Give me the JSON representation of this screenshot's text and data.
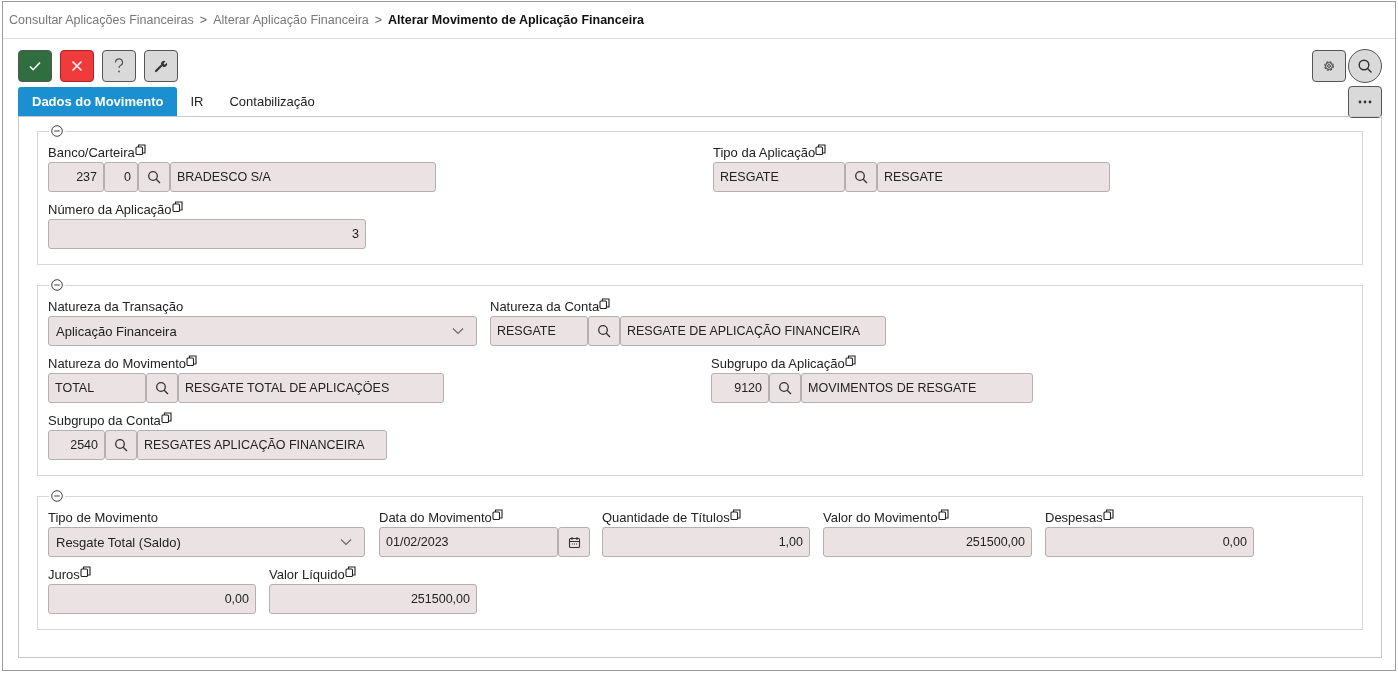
{
  "breadcrumb": [
    {
      "label": "Consultar Aplicações Financeiras",
      "current": false
    },
    {
      "label": "Alterar Aplicação Financeira",
      "current": false
    },
    {
      "label": "Alterar Movimento de Aplicação Financeira",
      "current": true
    }
  ],
  "breadcrumb_separator": ">",
  "tabs": [
    {
      "label": "Dados do Movimento",
      "selected": true
    },
    {
      "label": "IR",
      "selected": false
    },
    {
      "label": "Contabilização",
      "selected": false
    }
  ],
  "sections": [
    {
      "expanded": true,
      "rows": [
        [
          {
            "kind": "lookup",
            "label": "Banco/Carteira",
            "copyable": true,
            "numeric": true,
            "codes": [
              "237",
              "0"
            ],
            "description": "BRADESCO S/A"
          },
          {
            "kind": "lookup",
            "label": "Tipo da Aplicação",
            "copyable": true,
            "numeric": false,
            "codes": [
              "RESGATE"
            ],
            "description": "RESGATE"
          }
        ],
        [
          {
            "kind": "number",
            "label": "Número da Aplicação",
            "copyable": true,
            "value": "3"
          }
        ]
      ]
    },
    {
      "expanded": true,
      "rows": [
        [
          {
            "kind": "select",
            "label": "Natureza da Transação",
            "copyable": false,
            "value": "Aplicação Financeira"
          },
          {
            "kind": "lookup",
            "label": "Natureza da Conta",
            "copyable": true,
            "numeric": false,
            "codes": [
              "RESGATE"
            ],
            "description": "RESGATE DE APLICAÇÃO FINANCEIRA"
          }
        ],
        [
          {
            "kind": "lookup",
            "label": "Natureza do Movimento",
            "copyable": true,
            "numeric": false,
            "codes": [
              "TOTAL"
            ],
            "description": "RESGATE TOTAL DE APLICAÇÕES"
          },
          {
            "kind": "lookup",
            "label": "Subgrupo da Aplicação",
            "copyable": true,
            "numeric": true,
            "codes": [
              "9120"
            ],
            "description": "MOVIMENTOS DE RESGATE"
          }
        ],
        [
          {
            "kind": "lookup",
            "label": "Subgrupo da Conta",
            "copyable": true,
            "numeric": true,
            "codes": [
              "2540"
            ],
            "description": "RESGATES APLICAÇÃO FINANCEIRA"
          }
        ]
      ]
    },
    {
      "expanded": true,
      "rows": [
        [
          {
            "kind": "select",
            "label": "Tipo de Movimento",
            "copyable": false,
            "value": "Resgate Total (Saldo)"
          },
          {
            "kind": "date",
            "label": "Data do Movimento",
            "copyable": true,
            "value": "01/02/2023"
          },
          {
            "kind": "number",
            "label": "Quantidade de Títulos",
            "copyable": true,
            "value": "1,00"
          },
          {
            "kind": "number",
            "label": "Valor do Movimento",
            "copyable": true,
            "value": "251500,00"
          },
          {
            "kind": "number",
            "label": "Despesas",
            "copyable": true,
            "value": "0,00"
          }
        ],
        [
          {
            "kind": "number",
            "label": "Juros",
            "copyable": true,
            "value": "0,00"
          },
          {
            "kind": "number",
            "label": "Valor Líquido",
            "copyable": true,
            "value": "251500,00"
          }
        ]
      ]
    }
  ]
}
